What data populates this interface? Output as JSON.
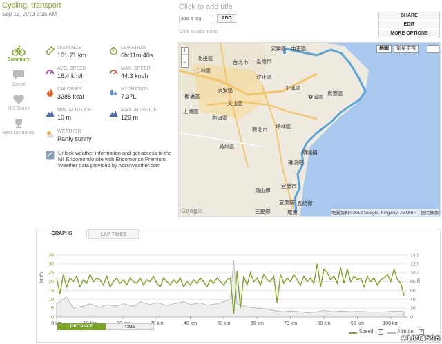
{
  "workout": {
    "title": "Cycling, transport",
    "date": "Sep 16, 2013 8:35 AM",
    "add_title": "Click to add title",
    "tag_placeholder": "add a tag",
    "add_label": "ADD",
    "add_notes": "Click to add notes"
  },
  "actions": {
    "share": "SHARE",
    "edit": "EDIT",
    "more": "MORE OPTIONS"
  },
  "nav": [
    {
      "label": "Summary",
      "icon": "bicycle-icon"
    },
    {
      "label": "Social",
      "icon": "speech-bubble-icon"
    },
    {
      "label": "HR Zones",
      "icon": "heart-icon"
    },
    {
      "label": "Best Distances",
      "icon": "trophy-icon"
    }
  ],
  "stats": {
    "distance": {
      "label": "DISTANCE",
      "value": "101.71 km",
      "icon": "ruler-icon"
    },
    "duration": {
      "label": "DURATION",
      "value": "6h:11m:40s",
      "icon": "stopwatch-icon"
    },
    "avg_speed": {
      "label": "AVG. SPEED",
      "value": "16.4 km/h",
      "icon": "speedometer-icon"
    },
    "max_speed": {
      "label": "MAX. SPEED",
      "value": "44.3 km/h",
      "icon": "speedometer-icon"
    },
    "calories": {
      "label": "CALORIES",
      "value": "3288 kcal",
      "icon": "flame-icon"
    },
    "hydration": {
      "label": "HYDRATION",
      "value": "7.37L",
      "icon": "water-drop-icon"
    },
    "min_altitude": {
      "label": "MIN. ALTITUDE",
      "value": "10 m",
      "icon": "mountain-icon"
    },
    "max_altitude": {
      "label": "MAX. ALTITUDE",
      "value": "129 m",
      "icon": "mountain-icon"
    },
    "weather": {
      "label": "WEATHER",
      "value": "Partly sunny",
      "icon": "partly-sunny-icon"
    }
  },
  "weather_note": {
    "text": "Unlock weather information and get access to the full Endomondo site with Endomondo Premium.",
    "provider": "Weather data provided by AccuWeather.com"
  },
  "map": {
    "map_button": "地圖",
    "satellite_button": "衛星檢視",
    "attribution": "地圖資料©2013 Google, Kingway, ZENRIN - 使用條款",
    "logo": "Google",
    "labels": [
      "北投區",
      "台北市",
      "基隆市",
      "安樂區",
      "中正區",
      "士林區",
      "汐止區",
      "大安區",
      "平溪區",
      "雙溪區",
      "貢寮區",
      "板橋區",
      "文山區",
      "土城區",
      "新店區",
      "新北市",
      "坪林區",
      "烏來區",
      "頭城鎮",
      "礁溪鄉",
      "員山鄉",
      "宜蘭市",
      "宜蘭縣",
      "三星鄉",
      "五結鄉",
      "羅東"
    ]
  },
  "graphs": {
    "tab_graphs": "GRAPHS",
    "tab_laps": "LAP TIMES",
    "toggle_distance": "DISTANCE",
    "toggle_time": "TIME",
    "legend_speed": "Speed",
    "legend_altitude": "Altitude",
    "watermark": "#1894596"
  },
  "chart_data": {
    "type": "line",
    "xlabel": "km",
    "ylabel": "km/h",
    "y2label": "m",
    "xlim": [
      0,
      105
    ],
    "ylim": [
      0,
      35
    ],
    "y2lim": [
      0,
      140
    ],
    "x_ticks": [
      "0 km",
      "10 km",
      "20 km",
      "30 km",
      "40 km",
      "50 km",
      "60 km",
      "70 km",
      "80 km",
      "90 km",
      "100 km"
    ],
    "y_ticks": [
      0,
      5,
      10,
      15,
      20,
      25,
      30,
      35
    ],
    "y2_ticks": [
      0,
      20,
      40,
      60,
      80,
      100,
      120,
      140
    ],
    "colors": {
      "speed": "#7ca626",
      "altitude": "#bbbbbb"
    },
    "series": [
      {
        "name": "Speed",
        "x": [
          0,
          1,
          2,
          3,
          4,
          5,
          6,
          7,
          8,
          9,
          10,
          11,
          12,
          13,
          14,
          15,
          16,
          17,
          18,
          19,
          20,
          21,
          22,
          23,
          24,
          25,
          26,
          27,
          28,
          29,
          30,
          31,
          32,
          33,
          34,
          35,
          36,
          37,
          38,
          39,
          40,
          41,
          42,
          43,
          44,
          45,
          46,
          47,
          48,
          49,
          50,
          51,
          52,
          53,
          54,
          55,
          56,
          57,
          58,
          59,
          60,
          61,
          62,
          63,
          64,
          65,
          66,
          67,
          68,
          69,
          70,
          71,
          72,
          73,
          74,
          75,
          76,
          77,
          78,
          79,
          80,
          81,
          82,
          83,
          84,
          85,
          86,
          87,
          88,
          89,
          90,
          91,
          92,
          93,
          94,
          95,
          96,
          97,
          98,
          99,
          100,
          101,
          102,
          103,
          104
        ],
        "values": [
          22,
          13,
          24,
          17,
          22,
          20,
          23,
          17,
          21,
          19,
          24,
          20,
          22,
          21,
          18,
          23,
          17,
          20,
          22,
          19,
          21,
          18,
          22,
          20,
          19,
          22,
          18,
          21,
          20,
          23,
          19,
          17,
          22,
          20,
          18,
          21,
          19,
          22,
          17,
          20,
          18,
          21,
          19,
          22,
          20,
          17,
          21,
          19,
          22,
          20,
          18,
          21,
          22,
          2,
          26,
          5,
          23,
          18,
          25,
          20,
          22,
          18,
          24,
          21,
          20,
          23,
          8,
          24,
          19,
          22,
          20,
          24,
          21,
          18,
          23,
          20,
          22,
          19,
          30,
          17,
          27,
          25,
          21,
          23,
          19,
          28,
          19,
          27,
          20,
          23,
          21,
          22,
          17,
          23,
          20,
          22,
          18,
          21,
          22,
          24,
          20,
          27,
          21,
          19,
          12
        ]
      },
      {
        "name": "Altitude",
        "x": [
          0,
          3,
          5,
          8,
          10,
          13,
          15,
          18,
          20,
          23,
          25,
          28,
          30,
          33,
          35,
          38,
          40,
          43,
          45,
          48,
          50,
          52,
          53,
          54,
          56,
          58,
          60,
          63,
          65,
          68,
          70,
          73,
          75,
          78,
          80,
          83,
          85,
          88,
          90,
          93,
          95,
          98,
          100,
          103,
          104
        ],
        "values": [
          30,
          45,
          20,
          25,
          30,
          22,
          28,
          25,
          30,
          24,
          35,
          28,
          33,
          26,
          30,
          35,
          28,
          32,
          27,
          30,
          35,
          40,
          129,
          30,
          25,
          22,
          20,
          18,
          15,
          12,
          14,
          12,
          10,
          12,
          15,
          12,
          14,
          12,
          13,
          12,
          11,
          12,
          13,
          14,
          12
        ]
      }
    ]
  }
}
